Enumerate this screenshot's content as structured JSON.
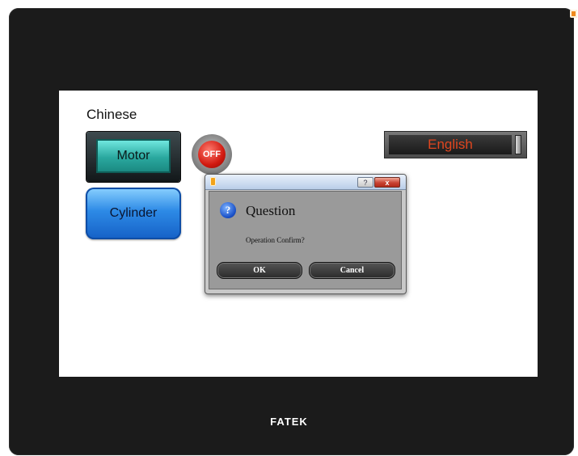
{
  "device": {
    "brand": "FATEK"
  },
  "screen": {
    "language_label": "Chinese",
    "motor_button": "Motor",
    "cylinder_button": "Cylinder",
    "off_lamp": "OFF",
    "english_button": "English"
  },
  "dialog": {
    "help_glyph": "?",
    "close_glyph": "x",
    "icon_glyph": "?",
    "title": "Question",
    "message": "Operation Confirm?",
    "ok_label": "OK",
    "cancel_label": "Cancel"
  },
  "icons": [
    "question-icon",
    "lock-icon",
    "help-icon",
    "close-icon"
  ],
  "colors": {
    "bezel": "#1b1b1b",
    "motor_teal": "#2aa89f",
    "cylinder_blue": "#2d8ae6",
    "off_red": "#d11a10",
    "english_text": "#e0461f"
  }
}
